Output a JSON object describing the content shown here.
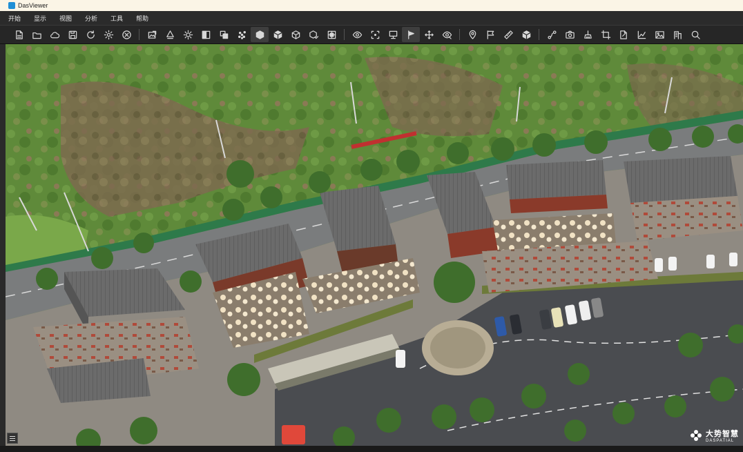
{
  "window": {
    "title": "DasViewer"
  },
  "menu": {
    "items": [
      "开始",
      "显示",
      "视图",
      "分析",
      "工具",
      "帮助"
    ]
  },
  "toolbar": {
    "groups": [
      [
        "new-file-icon",
        "open-folder-icon",
        "cloud-icon",
        "save-icon",
        "refresh-icon",
        "settings-icon",
        "close-circle-icon"
      ],
      [
        "image-export-icon",
        "light-icon",
        "sun-icon",
        "split-view-icon",
        "layers-icon",
        "point-cloud-icon",
        "cube-solid-icon",
        "cube-filled-icon",
        "cube-wire-icon",
        "cube-check-icon",
        "grid-icon"
      ],
      [
        "eye-icon",
        "frame-icon",
        "monitor-icon",
        "flag-pole-icon",
        "move-icon",
        "eye-off-icon"
      ],
      [
        "location-pin-icon",
        "flag-icon",
        "ruler-icon",
        "volume-icon"
      ],
      [
        "route-icon",
        "camera-icon",
        "brush-icon",
        "crop-icon",
        "doc-export-icon",
        "chart-icon",
        "picture-icon",
        "building-icon",
        "search-icon"
      ]
    ],
    "active": [
      "cube-solid-icon",
      "flag-pole-icon"
    ]
  },
  "watermark": {
    "cn": "大势智慧",
    "en": "DASPATIAL"
  }
}
